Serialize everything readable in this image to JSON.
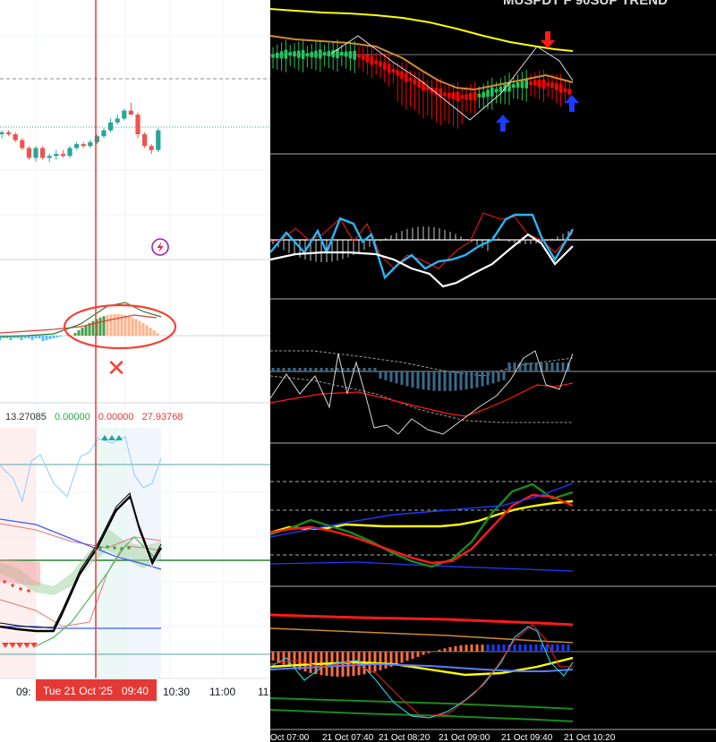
{
  "left_panel": {
    "indicator_values": [
      {
        "text": "13.27085",
        "color": "#333333"
      },
      {
        "text": "0.00000",
        "color": "#22a846"
      },
      {
        "text": "0.00000",
        "color": "#e53935"
      },
      {
        "text": "27.93768",
        "color": "#e53935"
      }
    ],
    "time_axis": {
      "labels": [
        "09:",
        "10:30",
        "11:00",
        "11:"
      ],
      "cursor_label": "Tue 21 Oct '25   09:40"
    },
    "annotation_mark": "✕"
  },
  "right_panel": {
    "title_fragment": "MUSPDT F 90SUP TREND",
    "time_axis_labels": [
      "Oct 07:00",
      "21 Oct 07:40",
      "21 Oct 08:20",
      "21 Oct 09:00",
      "21 Oct 09:40",
      "21 Oct 10:20"
    ]
  },
  "colors": {
    "bull": "#26a69a",
    "bear": "#ef5350",
    "cursor": "#e53935",
    "mt_bg": "#000000",
    "mt_bull": "#22c55e",
    "mt_bear": "#ff0000",
    "yellow": "#ffff00",
    "orange": "#d08a30",
    "cyan": "#29b6f6",
    "blue_arrow": "#1a3cff"
  },
  "chart_data": [
    {
      "type": "candlestick",
      "panel": "left-price",
      "candles": [
        [
          0.5,
          0.52,
          0.48,
          0.51
        ],
        [
          0.51,
          0.52,
          0.49,
          0.5
        ],
        [
          0.5,
          0.51,
          0.46,
          0.47
        ],
        [
          0.47,
          0.48,
          0.42,
          0.43
        ],
        [
          0.43,
          0.44,
          0.37,
          0.38
        ],
        [
          0.38,
          0.44,
          0.36,
          0.43
        ],
        [
          0.43,
          0.44,
          0.37,
          0.38
        ],
        [
          0.38,
          0.4,
          0.36,
          0.39
        ],
        [
          0.39,
          0.42,
          0.37,
          0.4
        ],
        [
          0.4,
          0.42,
          0.38,
          0.39
        ],
        [
          0.39,
          0.44,
          0.38,
          0.43
        ],
        [
          0.43,
          0.46,
          0.42,
          0.45
        ],
        [
          0.45,
          0.46,
          0.43,
          0.44
        ],
        [
          0.44,
          0.47,
          0.43,
          0.46
        ],
        [
          0.46,
          0.5,
          0.45,
          0.49
        ],
        [
          0.49,
          0.53,
          0.48,
          0.52
        ],
        [
          0.52,
          0.58,
          0.51,
          0.56
        ],
        [
          0.56,
          0.6,
          0.55,
          0.58
        ],
        [
          0.58,
          0.63,
          0.57,
          0.62
        ],
        [
          0.62,
          0.66,
          0.6,
          0.6
        ],
        [
          0.6,
          0.61,
          0.48,
          0.5
        ],
        [
          0.5,
          0.51,
          0.43,
          0.44
        ],
        [
          0.44,
          0.45,
          0.4,
          0.42
        ],
        [
          0.42,
          0.53,
          0.41,
          0.52
        ]
      ]
    },
    {
      "type": "line",
      "panel": "right-price",
      "series": [
        {
          "values": [
            0.92,
            0.93,
            0.94,
            0.94,
            0.93,
            0.92,
            0.91,
            0.89,
            0.86,
            0.84,
            0.8,
            0.77,
            0.74,
            0.72,
            0.71,
            0.7,
            0.69,
            0.68
          ]
        },
        {
          "values": [
            0.7,
            0.72,
            0.71,
            0.72,
            0.72,
            0.7,
            0.64,
            0.56,
            0.48,
            0.4,
            0.35,
            0.33,
            0.35,
            0.4,
            0.44,
            0.46,
            0.44,
            0.38
          ]
        }
      ]
    },
    {
      "type": "line",
      "panel": "right-oscillator-4",
      "series": [
        {
          "values": [
            0.4,
            0.46,
            0.44,
            0.45,
            0.49,
            0.48,
            0.47,
            0.47,
            0.47,
            0.47,
            0.49,
            0.53,
            0.6,
            0.66,
            0.7,
            0.73,
            0.75
          ]
        },
        {
          "values": [
            0.38,
            0.45,
            0.54,
            0.47,
            0.4,
            0.3,
            0.18,
            0.08,
            0.02,
            0.1,
            0.3,
            0.62,
            0.86,
            0.94,
            0.78,
            0.85
          ]
        },
        {
          "values": [
            0.4,
            0.44,
            0.46,
            0.42,
            0.36,
            0.28,
            0.2,
            0.12,
            0.06,
            0.08,
            0.22,
            0.46,
            0.7,
            0.82,
            0.8,
            0.7
          ]
        }
      ]
    }
  ]
}
